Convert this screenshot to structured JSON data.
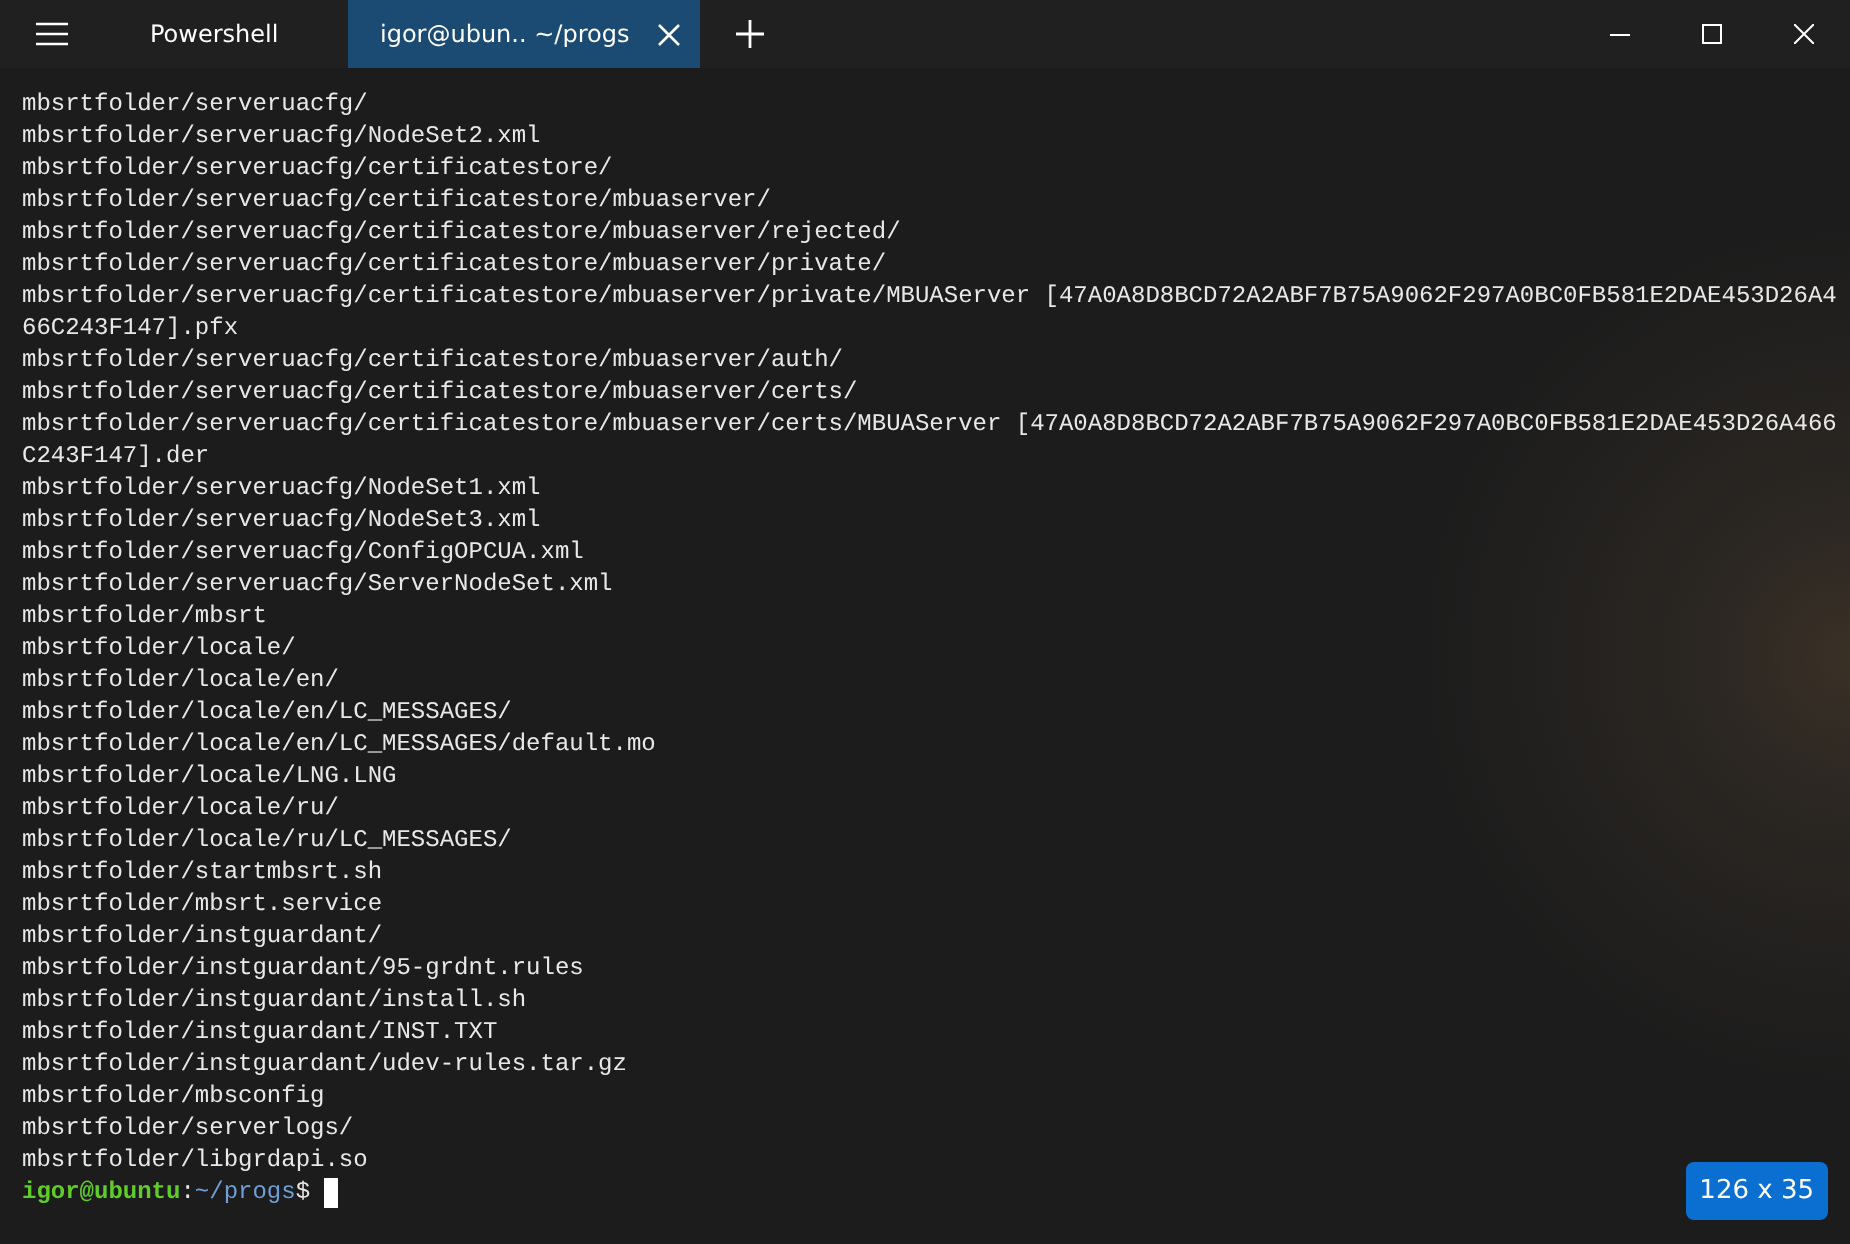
{
  "tabs": [
    {
      "title": "Powershell",
      "selected": false,
      "closable": false
    },
    {
      "title": "igor@ubun.. ~/progs",
      "selected": true,
      "closable": true
    }
  ],
  "lines": [
    "mbsrtfolder/serveruacfg/",
    "mbsrtfolder/serveruacfg/NodeSet2.xml",
    "mbsrtfolder/serveruacfg/certificatestore/",
    "mbsrtfolder/serveruacfg/certificatestore/mbuaserver/",
    "mbsrtfolder/serveruacfg/certificatestore/mbuaserver/rejected/",
    "mbsrtfolder/serveruacfg/certificatestore/mbuaserver/private/",
    "mbsrtfolder/serveruacfg/certificatestore/mbuaserver/private/MBUAServer [47A0A8D8BCD72A2ABF7B75A9062F297A0BC0FB581E2DAE453D26A4",
    "66C243F147].pfx",
    "mbsrtfolder/serveruacfg/certificatestore/mbuaserver/auth/",
    "mbsrtfolder/serveruacfg/certificatestore/mbuaserver/certs/",
    "mbsrtfolder/serveruacfg/certificatestore/mbuaserver/certs/MBUAServer [47A0A8D8BCD72A2ABF7B75A9062F297A0BC0FB581E2DAE453D26A466",
    "C243F147].der",
    "mbsrtfolder/serveruacfg/NodeSet1.xml",
    "mbsrtfolder/serveruacfg/NodeSet3.xml",
    "mbsrtfolder/serveruacfg/ConfigOPCUA.xml",
    "mbsrtfolder/serveruacfg/ServerNodeSet.xml",
    "mbsrtfolder/mbsrt",
    "mbsrtfolder/locale/",
    "mbsrtfolder/locale/en/",
    "mbsrtfolder/locale/en/LC_MESSAGES/",
    "mbsrtfolder/locale/en/LC_MESSAGES/default.mo",
    "mbsrtfolder/locale/LNG.LNG",
    "mbsrtfolder/locale/ru/",
    "mbsrtfolder/locale/ru/LC_MESSAGES/",
    "mbsrtfolder/startmbsrt.sh",
    "mbsrtfolder/mbsrt.service",
    "mbsrtfolder/instguardant/",
    "mbsrtfolder/instguardant/95-grdnt.rules",
    "mbsrtfolder/instguardant/install.sh",
    "mbsrtfolder/instguardant/INST.TXT",
    "mbsrtfolder/instguardant/udev-rules.tar.gz",
    "mbsrtfolder/mbsconfig",
    "mbsrtfolder/serverlogs/",
    "mbsrtfolder/libgrdapi.so"
  ],
  "prompt": {
    "user_host": "igor@ubuntu",
    "separator": ":",
    "path": "~/progs",
    "symbol": "$"
  },
  "size_badge": "126 x 35"
}
